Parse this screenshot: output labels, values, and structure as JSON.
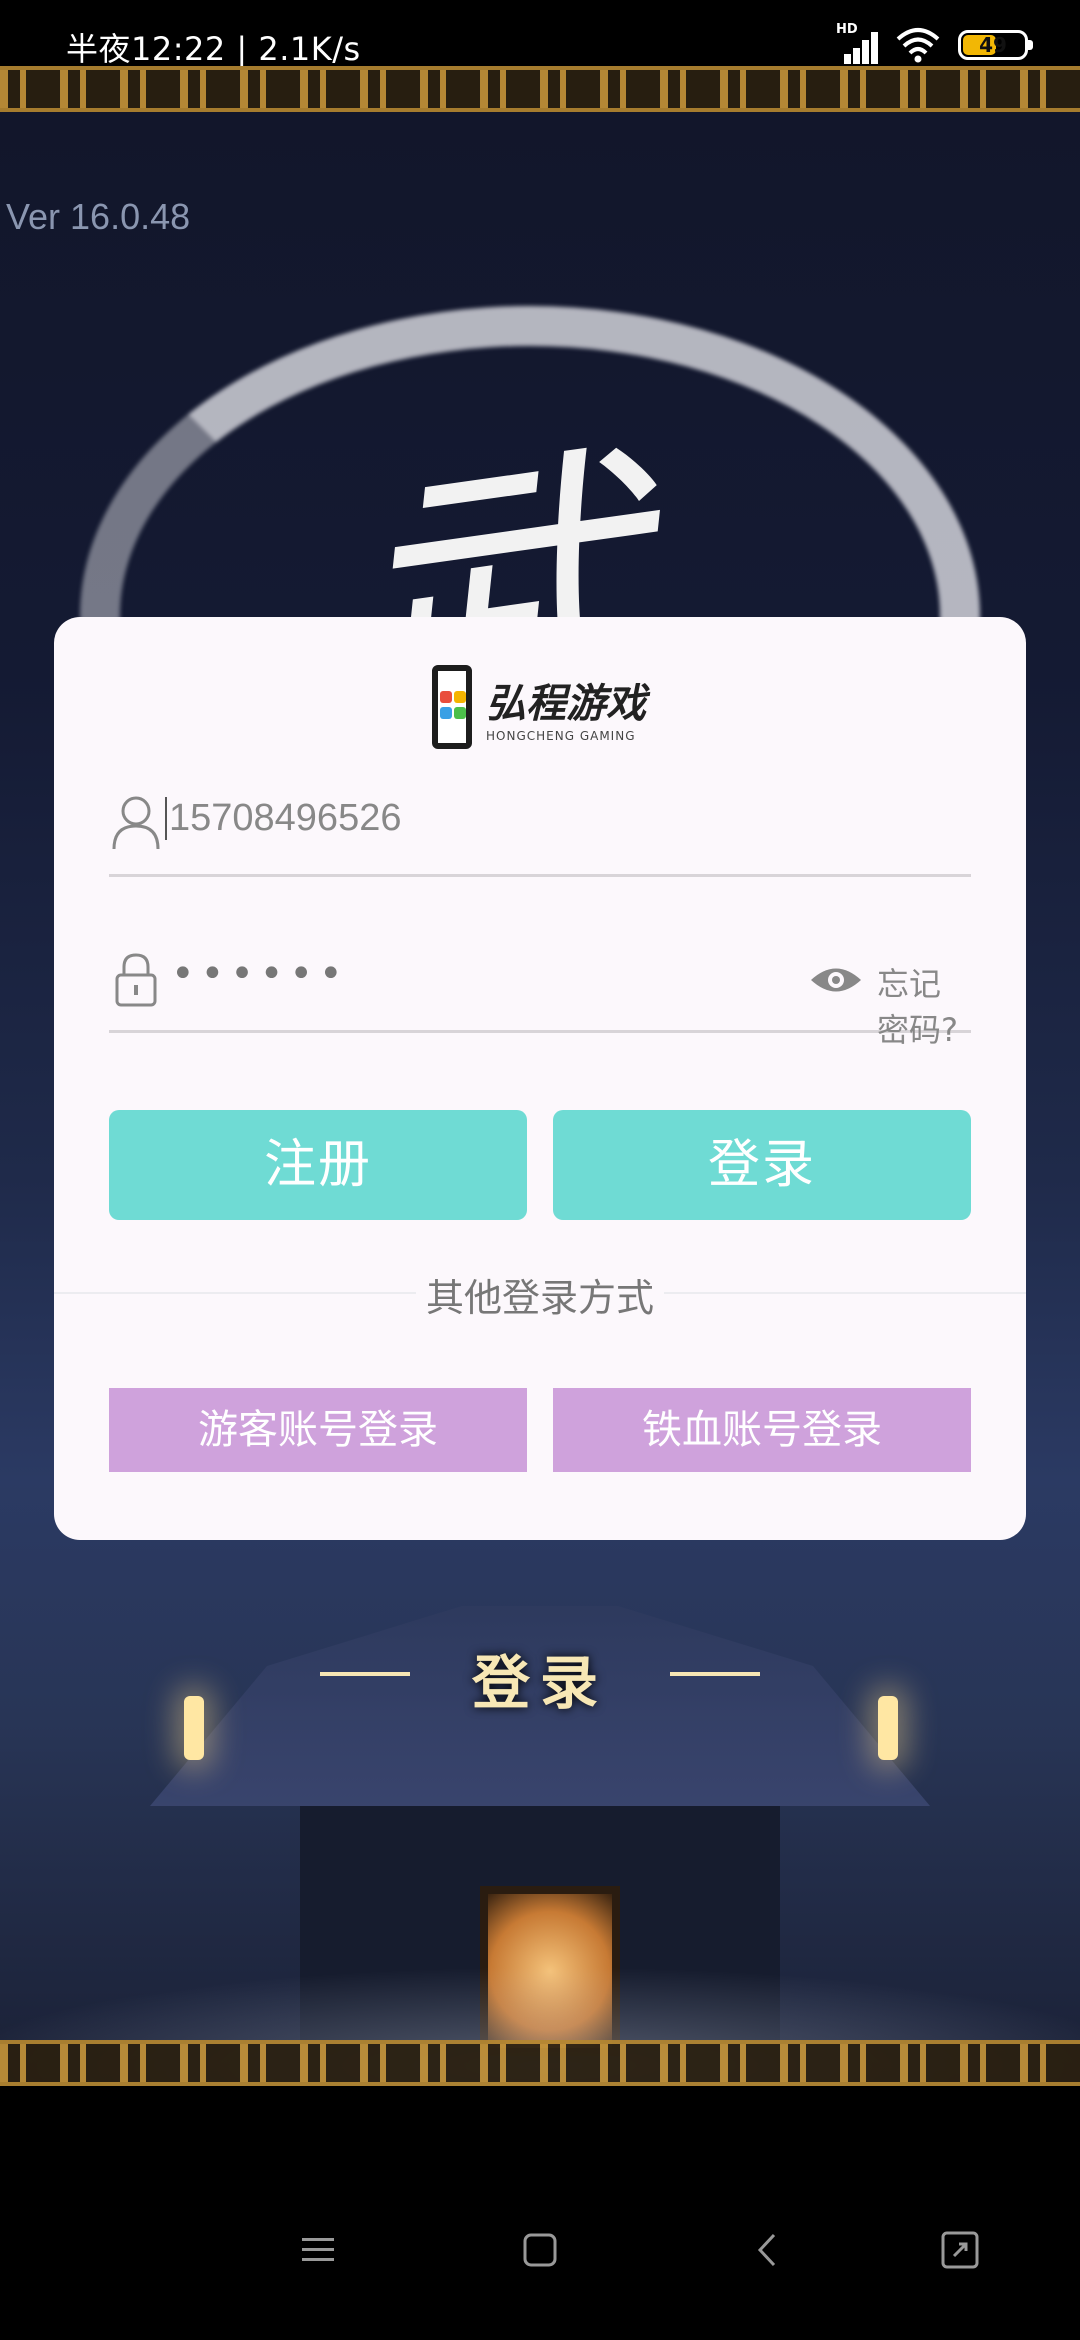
{
  "status_bar": {
    "time_speed": "半夜12:22 | 2.1K/s",
    "signal_badge": "HD",
    "battery": "49"
  },
  "game": {
    "version": "Ver 16.0.48",
    "title_glyph": "武",
    "banner": "登录"
  },
  "dialog": {
    "logo_cn": "弘程游戏",
    "logo_en": "HONGCHENG GAMING",
    "username_value": "15708496526",
    "password_mask": "••••••",
    "forgot_label": "忘记密码?",
    "register_label": "注册",
    "login_label": "登录",
    "other_methods_label": "其他登录方式",
    "guest_label": "游客账号登录",
    "tiexue_label": "铁血账号登录"
  },
  "colors": {
    "teal_button": "#6fdbd4",
    "purple_button": "#cfa2dc",
    "dialog_bg": "#fcf8fc"
  }
}
